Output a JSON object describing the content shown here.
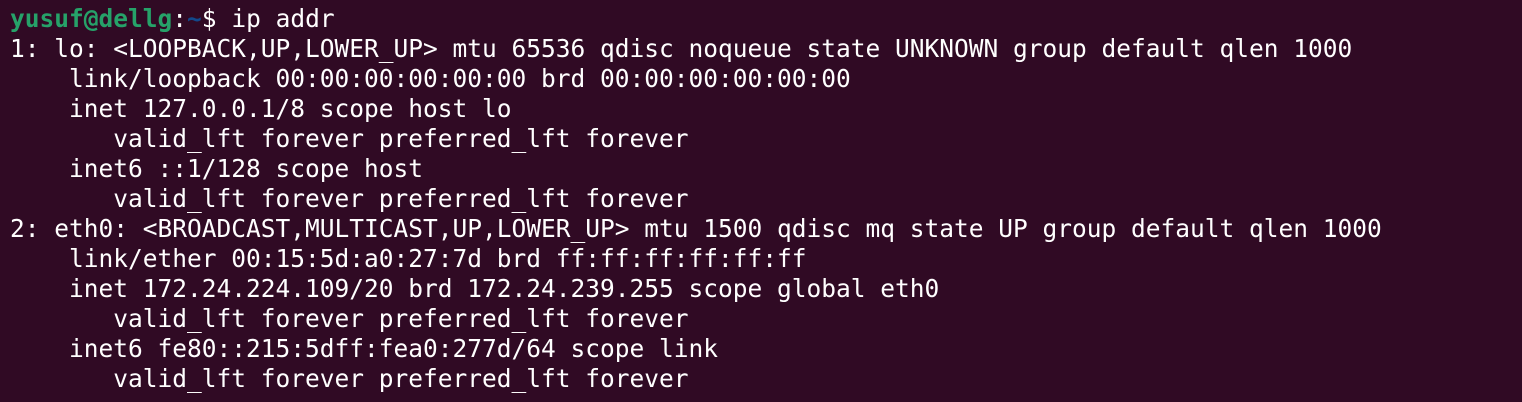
{
  "prompt": {
    "user_host": "yusuf@dellg",
    "separator": ":",
    "path": "~",
    "symbol": "$ ",
    "command": "ip addr"
  },
  "output": [
    "1: lo: <LOOPBACK,UP,LOWER_UP> mtu 65536 qdisc noqueue state UNKNOWN group default qlen 1000",
    "    link/loopback 00:00:00:00:00:00 brd 00:00:00:00:00:00",
    "    inet 127.0.0.1/8 scope host lo",
    "       valid_lft forever preferred_lft forever",
    "    inet6 ::1/128 scope host",
    "       valid_lft forever preferred_lft forever",
    "2: eth0: <BROADCAST,MULTICAST,UP,LOWER_UP> mtu 1500 qdisc mq state UP group default qlen 1000",
    "    link/ether 00:15:5d:a0:27:7d brd ff:ff:ff:ff:ff:ff",
    "    inet 172.24.224.109/20 brd 172.24.239.255 scope global eth0",
    "       valid_lft forever preferred_lft forever",
    "    inet6 fe80::215:5dff:fea0:277d/64 scope link",
    "       valid_lft forever preferred_lft forever"
  ],
  "colors": {
    "background": "#300a24",
    "foreground": "#ffffff",
    "prompt_user": "#26a269",
    "prompt_path": "#12488b"
  }
}
